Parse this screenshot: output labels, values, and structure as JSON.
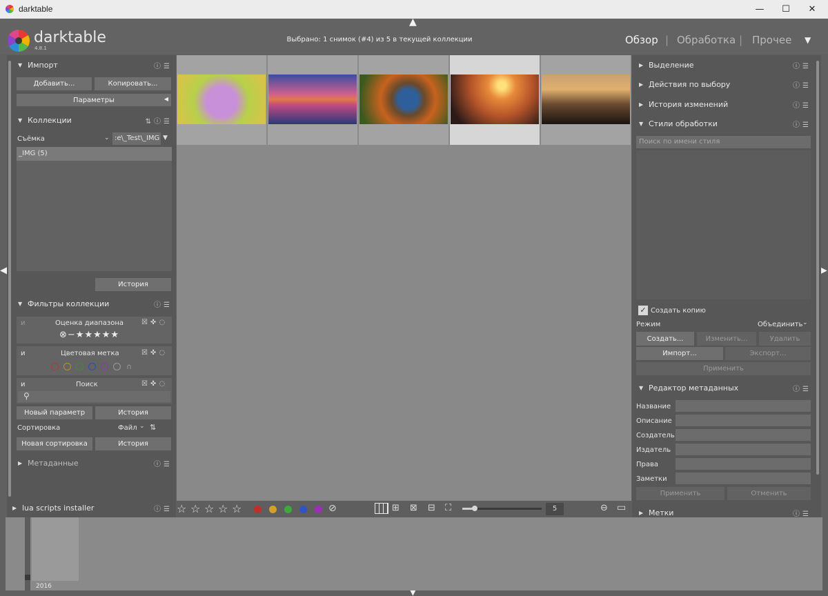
{
  "window": {
    "title": "darktable",
    "minimize": "—",
    "maximize": "☐",
    "close": "✕"
  },
  "header": {
    "app_name": "darktable",
    "version": "4.8.1",
    "selection_info": "Выбрано: 1 снимок (#4) из 5 в текущей коллекции",
    "views": {
      "lighttable": "Обзор",
      "darkroom": "Обработка",
      "other": "Прочее"
    },
    "separator": "|",
    "dropdown": "▼"
  },
  "left": {
    "import": {
      "title": "Импорт",
      "add": "Добавить...",
      "copy": "Копировать...",
      "params": "Параметры"
    },
    "collections": {
      "title": "Коллекции",
      "property": "Съёмка",
      "value": ":e\\_Test\\_IMG",
      "items": [
        "_IMG (5)"
      ],
      "history": "История"
    },
    "filters": {
      "title": "Фильтры коллекции",
      "rating_title": "Оценка диапазона",
      "color_title": "Цветовая метка",
      "search_title": "Поиск",
      "and": "и",
      "new_param": "Новый параметр",
      "history": "История"
    },
    "sort": {
      "label": "Сортировка",
      "value": "Файл",
      "new": "Новая сортировка",
      "history": "История"
    },
    "metadata": {
      "title": "Метаданные"
    },
    "lua": {
      "title": "lua scripts installer"
    }
  },
  "right": {
    "selection": {
      "title": "Выделение"
    },
    "actions": {
      "title": "Действия по выбору"
    },
    "history": {
      "title": "История изменений"
    },
    "styles": {
      "title": "Стили обработки",
      "search_placeholder": "Поиск по имени стиля",
      "create_copy": "Создать копию",
      "mode_label": "Режим",
      "mode_value": "Объединить",
      "create": "Создать...",
      "edit": "Изменить...",
      "delete": "Удалить",
      "import": "Импорт...",
      "export": "Экспорт...",
      "apply": "Применить"
    },
    "metadata_editor": {
      "title": "Редактор метаданных",
      "fields": [
        "Название",
        "Описание",
        "Создатель",
        "Издатель",
        "Права",
        "Заметки"
      ],
      "apply": "Применить",
      "cancel": "Отменить"
    },
    "tags": {
      "title": "Метки"
    }
  },
  "thumbnails": {
    "count": 5,
    "selected_index": 4,
    "colors": [
      "#d7c46a",
      "#c45a7a",
      "#4a6f2a",
      "#d9743a",
      "#6a4d30"
    ]
  },
  "toolbar": {
    "zoom_value": "5",
    "color_labels": [
      "#c0302a",
      "#d3a12a",
      "#3fa83a",
      "#2f54c4",
      "#9c2fb8"
    ]
  },
  "filmstrip": {
    "year": "2016"
  }
}
